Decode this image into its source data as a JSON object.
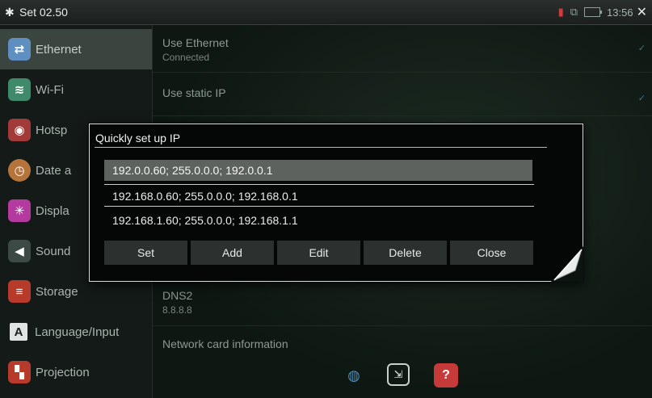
{
  "statusbar": {
    "title": "Set 02.50",
    "time": "13:56",
    "icons": [
      "gear-icon",
      "sd-card-icon",
      "network-icon",
      "battery-icon",
      "close-icon"
    ]
  },
  "sidebar": {
    "items": [
      {
        "label": "Ethernet",
        "icon": "ethernet-icon",
        "color": "#5f8fc0",
        "glyph": "⇄"
      },
      {
        "label": "Wi-Fi",
        "icon": "wifi-icon",
        "color": "#3f8a6a",
        "glyph": "≋"
      },
      {
        "label": "Hotsp",
        "icon": "hotspot-icon",
        "color": "#a23a3a",
        "glyph": "◉"
      },
      {
        "label": "Date a",
        "icon": "clock-icon",
        "color": "#b5753a",
        "glyph": "◷"
      },
      {
        "label": "Displa",
        "icon": "display-icon",
        "color": "#b53aa0",
        "glyph": "✳"
      },
      {
        "label": "Sound",
        "icon": "speaker-icon",
        "color": "#3b4a45",
        "glyph": "◀"
      },
      {
        "label": "Storage",
        "icon": "storage-icon",
        "color": "#b83a2a",
        "glyph": "≡"
      },
      {
        "label": "Language/Input",
        "icon": "language-icon",
        "color": "#dfe3e1",
        "glyph": "A"
      },
      {
        "label": "Projection",
        "icon": "projection-icon",
        "color": "#b83a2a",
        "glyph": "▚"
      }
    ]
  },
  "main": {
    "use_ethernet": {
      "title": "Use Ethernet",
      "sub": "Connected"
    },
    "use_static_ip": {
      "title": "Use static IP"
    },
    "dns2": {
      "title": "DNS2",
      "value": "8.8.8.8"
    },
    "network_card": {
      "title": "Network card information"
    }
  },
  "dialog": {
    "title": "Quickly set up IP",
    "items": [
      "192.0.0.60; 255.0.0.0; 192.0.0.1",
      "192.168.0.60; 255.0.0.0; 192.168.0.1",
      "192.168.1.60; 255.0.0.0; 192.168.1.1"
    ],
    "selected_index": 0,
    "buttons": [
      "Set",
      "Add",
      "Edit",
      "Delete",
      "Close"
    ]
  },
  "bottom_bar": {
    "icons": [
      "globe-icon",
      "exit-icon",
      "help-icon"
    ],
    "help_label": "?"
  },
  "colors": {
    "accent_check": "#4b6f86",
    "dialog_bg": "#050706",
    "selected_row": "#5d625f"
  }
}
